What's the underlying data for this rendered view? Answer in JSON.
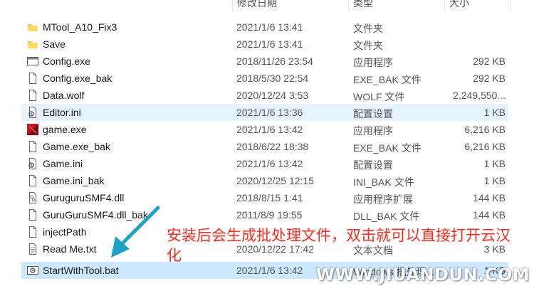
{
  "header": {
    "date_col": "修改日期",
    "type_col": "类型",
    "size_col": "大小"
  },
  "files": [
    {
      "name": "MTool_A10_Fix3",
      "date": "2021/1/6 13:41",
      "type": "文件夹",
      "size": "",
      "icon": "folder-icon"
    },
    {
      "name": "Save",
      "date": "2021/1/6 13:41",
      "type": "文件夹",
      "size": "",
      "icon": "folder-icon"
    },
    {
      "name": "Config.exe",
      "date": "2018/11/26 23:54",
      "type": "应用程序",
      "size": "292 KB",
      "icon": "app-window-icon"
    },
    {
      "name": "Config.exe_bak",
      "date": "2018/5/30 22:54",
      "type": "EXE_BAK 文件",
      "size": "292 KB",
      "icon": "file-icon"
    },
    {
      "name": "Data.wolf",
      "date": "2020/12/24 3:53",
      "type": "WOLF 文件",
      "size": "2,249,550...",
      "icon": "file-icon"
    },
    {
      "name": "Editor.ini",
      "date": "2021/1/6 13:36",
      "type": "配置设置",
      "size": "1 KB",
      "icon": "settings-file-icon"
    },
    {
      "name": "game.exe",
      "date": "2021/1/6 13:42",
      "type": "应用程序",
      "size": "6,216 KB",
      "icon": "game-exe-icon"
    },
    {
      "name": "Game.exe_bak",
      "date": "2018/6/22 18:38",
      "type": "EXE_BAK 文件",
      "size": "6,216 KB",
      "icon": "file-icon"
    },
    {
      "name": "Game.ini",
      "date": "2021/1/6 13:42",
      "type": "配置设置",
      "size": "1 KB",
      "icon": "settings-file-icon"
    },
    {
      "name": "Game.ini_bak",
      "date": "2020/12/25 12:15",
      "type": "INI_BAK 文件",
      "size": "1 KB",
      "icon": "file-icon"
    },
    {
      "name": "GuruguruSMF4.dll",
      "date": "2018/8/15 1:41",
      "type": "应用程序扩展",
      "size": "144 KB",
      "icon": "dll-file-icon"
    },
    {
      "name": "GuruGuruSMF4.dll_bak",
      "date": "2011/8/9 19:55",
      "type": "DLL_BAK 文件",
      "size": "144 KB",
      "icon": "file-icon"
    },
    {
      "name": "injectPath",
      "date": "",
      "type": "",
      "size": "",
      "icon": "file-icon"
    },
    {
      "name": "Read Me.txt",
      "date": "2020/12/22 17:42",
      "type": "文本文档",
      "size": "3 KB",
      "icon": "text-file-icon"
    },
    {
      "name": "StartWithTool.bat",
      "date": "2021/1/6 13:42",
      "type": "Windows 批处理...",
      "size": "1 KB",
      "icon": "batch-file-icon"
    }
  ],
  "annotation": "安装后会生成批处理文件，双击就可以直接打开云汉化",
  "watermark": "WWW.JIUANDUN.COM",
  "colors": {
    "selected_row": "#cce8ff",
    "hover_row": "#e5f3ff",
    "annotation": "#ff2a1a",
    "arrow": "#1aa3c7"
  }
}
